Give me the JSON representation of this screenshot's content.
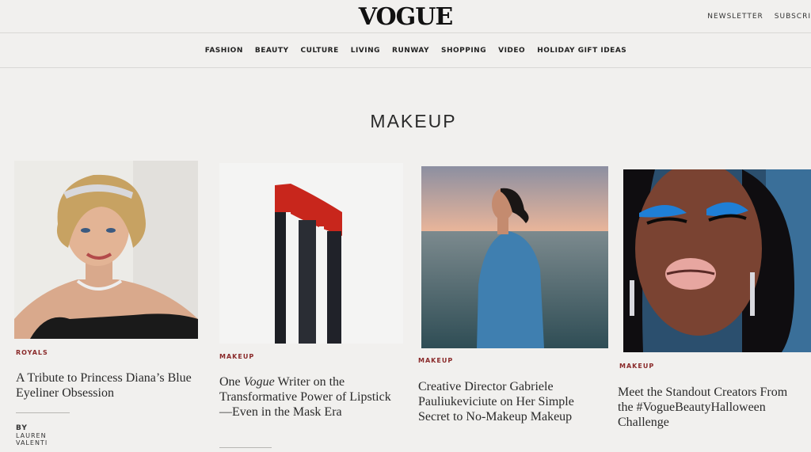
{
  "header": {
    "logo": "VOGUE",
    "links": [
      "NEWSLETTER",
      "SUBSCRI"
    ]
  },
  "nav": {
    "items": [
      "FASHION",
      "BEAUTY",
      "CULTURE",
      "LIVING",
      "RUNWAY",
      "SHOPPING",
      "VIDEO",
      "HOLIDAY GIFT IDEAS"
    ]
  },
  "section": {
    "title": "MAKEUP"
  },
  "cards": [
    {
      "tag": "ROYALS",
      "headline": "A Tribute to Princess Diana’s Blue Eyeliner Obsession",
      "byline_prefix": "BY",
      "author": "LAUREN VALENTI"
    },
    {
      "tag": "MAKEUP",
      "headline_a": "One ",
      "headline_em": "Vogue",
      "headline_b": " Writer on the Transformative Power of Lipstick—Even in the Mask Era"
    },
    {
      "tag": "MAKEUP",
      "headline": "Creative Director Gabriele Pauliukeviciute on Her Simple Secret to No-Makeup Makeup"
    },
    {
      "tag": "MAKEUP",
      "headline": "Meet the Standout Creators From the #VogueBeautyHalloween Challenge"
    }
  ],
  "colors": {
    "background": "#f1f0ee",
    "tag": "#8a2a2a",
    "lipstick_red": "#c8261c",
    "sea": "#3b5a64",
    "eyeshadow_blue": "#1f7fd6"
  }
}
